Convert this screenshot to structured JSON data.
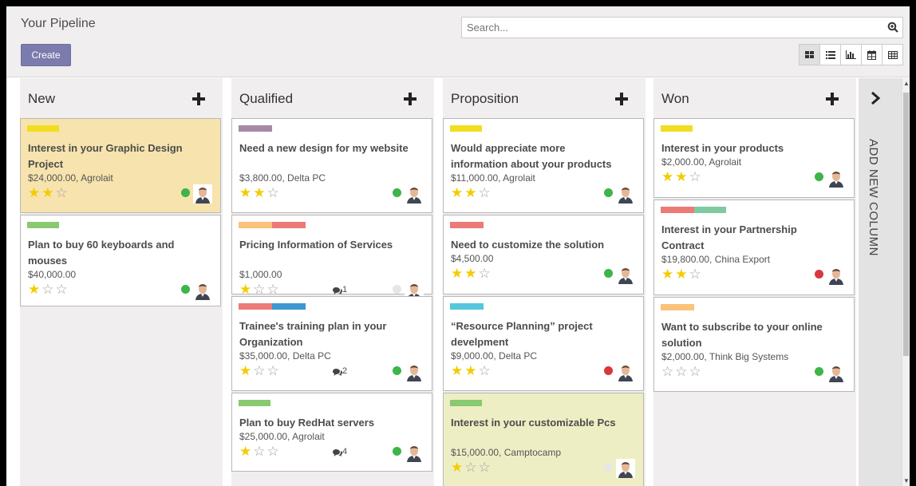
{
  "header": {
    "title": "Your Pipeline",
    "create_label": "Create",
    "search_placeholder": "Search...",
    "views": [
      {
        "icon": "kanban-icon",
        "active": true
      },
      {
        "icon": "list-icon",
        "active": false
      },
      {
        "icon": "graph-icon",
        "active": false
      },
      {
        "icon": "calendar-icon",
        "active": false
      },
      {
        "icon": "pivot-icon",
        "active": false
      }
    ]
  },
  "add_column_label": "ADD NEW COLUMN",
  "colors": {
    "yellow": "#f2dd1f",
    "green": "#89c96f",
    "purple": "#a689a7",
    "orange": "#fbc27a",
    "red": "#ec7a77",
    "blue": "#3c96d2",
    "teal": "#55c7dd",
    "lightgreen": "#7fcaa0",
    "dot_green": "#3eb449",
    "dot_red": "#d8383b",
    "dot_grey": "#e6e6e6"
  },
  "columns": [
    {
      "title": "New",
      "cards": [
        {
          "tags": [
            "yellow"
          ],
          "title": "Interest in your Graphic Design Project",
          "subtitle": "$24,000.00, Agrolait",
          "stars": 2,
          "dot": "green",
          "messages": "",
          "highlight": "c-yellow"
        },
        {
          "tags": [
            "green"
          ],
          "title": "Plan to buy 60 keyboards and mouses",
          "subtitle": "$40,000.00",
          "stars": 1,
          "dot": "green",
          "messages": "",
          "highlight": ""
        }
      ]
    },
    {
      "title": "Qualified",
      "cards": [
        {
          "tags": [
            "purple"
          ],
          "title": "Need a new design for my website",
          "subtitle": "$3,800.00, Delta PC",
          "stars": 2,
          "dot": "green",
          "messages": "",
          "highlight": ""
        },
        {
          "tags": [
            "orange",
            "red"
          ],
          "title": "Pricing Information of Services",
          "subtitle": "$1,000.00",
          "stars": 1,
          "dot": "grey",
          "messages": "1",
          "highlight": ""
        },
        {
          "tags": [
            "red",
            "blue"
          ],
          "title": "Trainee's training plan in your Organization",
          "subtitle": "$35,000.00, Delta PC",
          "stars": 1,
          "dot": "green",
          "messages": "2",
          "highlight": ""
        },
        {
          "tags": [
            "green"
          ],
          "title": "Plan to buy RedHat servers",
          "subtitle": "$25,000.00, Agrolait",
          "stars": 1,
          "dot": "green",
          "messages": "4",
          "highlight": ""
        }
      ]
    },
    {
      "title": "Proposition",
      "cards": [
        {
          "tags": [
            "yellow"
          ],
          "title": "Would appreciate more information about your products",
          "subtitle": "$11,000.00, Agrolait",
          "stars": 2,
          "dot": "green",
          "messages": "",
          "highlight": ""
        },
        {
          "tags": [
            "red"
          ],
          "title": "Need to customize the solution",
          "subtitle": "$4,500.00",
          "stars": 2,
          "dot": "green",
          "messages": "",
          "highlight": ""
        },
        {
          "tags": [
            "teal"
          ],
          "title": "“Resource Planning” project develpment",
          "subtitle": "$9,000.00, Delta PC",
          "stars": 2,
          "dot": "red",
          "messages": "",
          "highlight": ""
        },
        {
          "tags": [
            "green"
          ],
          "title": "Interest in your customizable Pcs",
          "subtitle": "$15,000.00, Camptocamp",
          "stars": 1,
          "dot": "grey",
          "messages": "",
          "highlight": "c-olive"
        }
      ]
    },
    {
      "title": "Won",
      "cards": [
        {
          "tags": [
            "yellow"
          ],
          "title": "Interest in your products",
          "subtitle": "$2,000.00, Agrolait",
          "stars": 2,
          "dot": "green",
          "messages": "",
          "highlight": ""
        },
        {
          "tags": [
            "red",
            "lightgreen"
          ],
          "title": "Interest in your Partnership Contract",
          "subtitle": "$19,800.00, China Export",
          "stars": 2,
          "dot": "red",
          "messages": "",
          "highlight": ""
        },
        {
          "tags": [
            "orange"
          ],
          "title": "Want to subscribe to your online solution",
          "subtitle": "$2,000.00, Think Big Systems",
          "stars": 0,
          "dot": "green",
          "messages": "",
          "highlight": ""
        }
      ]
    }
  ]
}
